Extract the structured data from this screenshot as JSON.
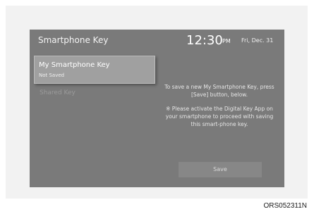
{
  "screen": {
    "title": "Smartphone Key",
    "time": "12:30",
    "ampm": "PM",
    "date": "Fri, Dec. 31"
  },
  "list": {
    "items": [
      {
        "label": "My Smartphone Key",
        "status": "Not Saved"
      },
      {
        "label": "Shared Key"
      }
    ]
  },
  "info": {
    "line1": "To save a new My Smartphone Key, press [Save] button, below.",
    "line2": "※ Please activate the Digital Key App on your smartphone to proceed with saving this smart-phone key."
  },
  "save_button": {
    "label": "Save"
  },
  "caption": "ORS052311N"
}
